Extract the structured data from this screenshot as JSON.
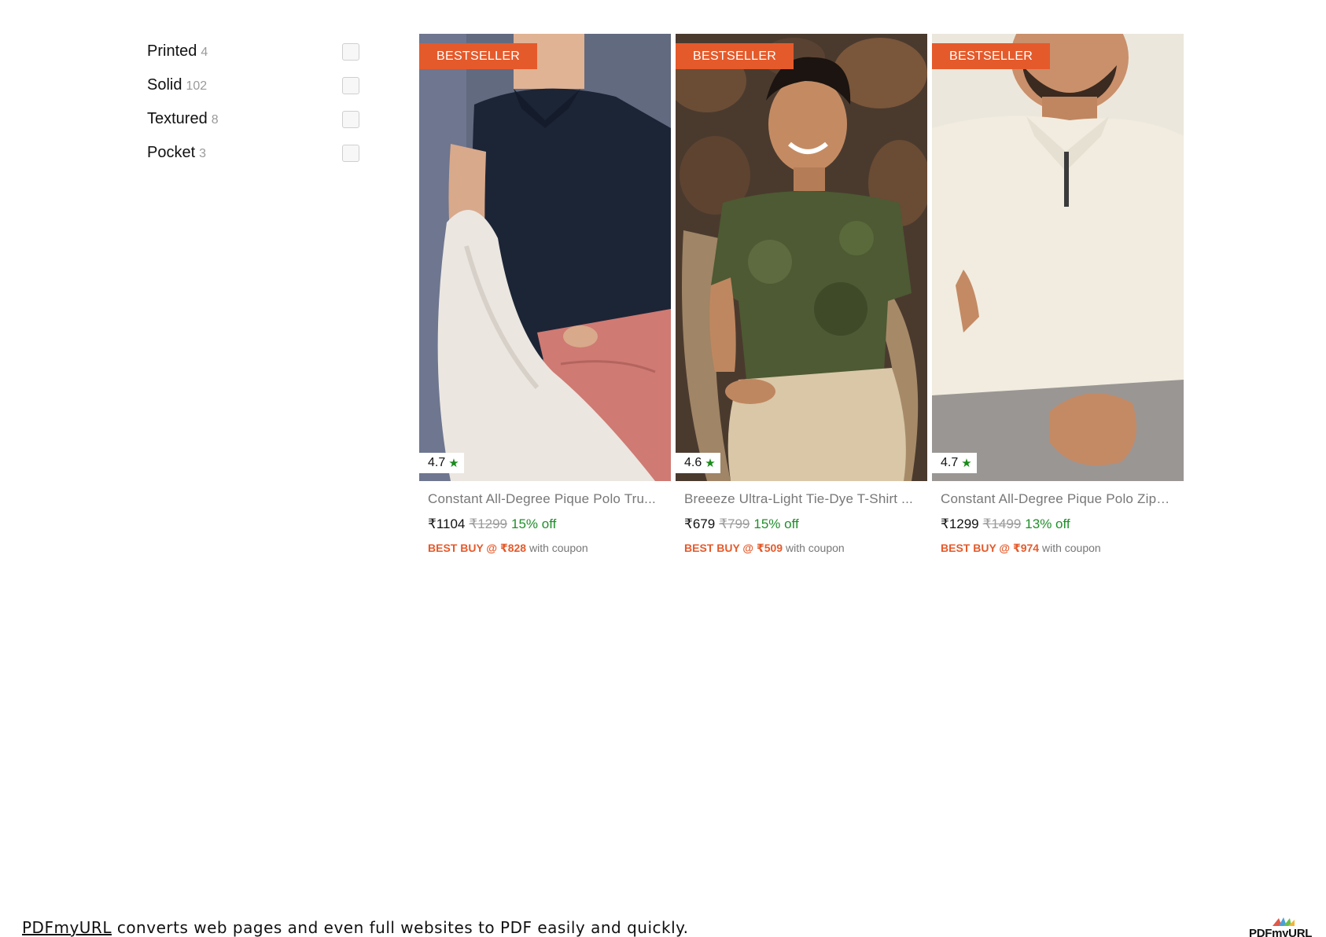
{
  "filters": [
    {
      "label": "Printed",
      "count": "4",
      "checked": false
    },
    {
      "label": "Solid",
      "count": "102",
      "checked": false
    },
    {
      "label": "Textured",
      "count": "8",
      "checked": false
    },
    {
      "label": "Pocket",
      "count": "3",
      "checked": false
    }
  ],
  "products": [
    {
      "badge": "BESTSELLER",
      "rating": "4.7",
      "title": "Constant All-Degree Pique Polo Tru...",
      "price": "₹1104",
      "mrp": "₹1299",
      "discount": "15% off",
      "coupon_prefix": "BEST BUY @ ₹828",
      "coupon_suffix": "with coupon",
      "image": "man-in-navy-polo-pink-shorts-on-white-chair"
    },
    {
      "badge": "BESTSELLER",
      "rating": "4.6",
      "title": "Breeeze Ultra-Light Tie-Dye T-Shirt ...",
      "price": "₹679",
      "mrp": "₹799",
      "discount": "15% off",
      "coupon_prefix": "BEST BUY @ ₹509",
      "coupon_suffix": "with coupon",
      "image": "smiling-man-in-olive-tie-dye-tshirt-on-rattan-chair"
    },
    {
      "badge": "BESTSELLER",
      "rating": "4.7",
      "title": "Constant All-Degree Pique Polo Zipp...",
      "price": "₹1299",
      "mrp": "₹1499",
      "discount": "13% off",
      "coupon_prefix": "BEST BUY @ ₹974",
      "coupon_suffix": "with coupon",
      "image": "man-in-cream-zip-polo-grey-shorts"
    }
  ],
  "footer": {
    "link": "PDFmyURL",
    "text": " converts web pages and even full websites to PDF easily and quickly.",
    "logo": "PDFmyURL"
  },
  "colors": {
    "accent": "#e55a2b",
    "discount": "#1f8f2a",
    "muted": "#9a9a9a"
  },
  "icons": {
    "rating": "star-icon"
  }
}
